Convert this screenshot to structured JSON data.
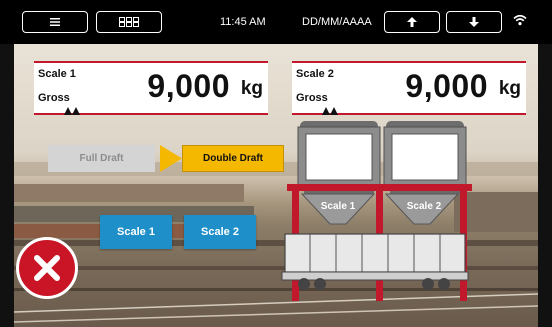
{
  "topbar": {
    "menu_icon": "menu-icon",
    "grid_icon": "grid-icon",
    "time": "11:45 AM",
    "date": "DD/MM/AAAA",
    "up_icon": "arrow-up-icon",
    "down_icon": "arrow-down-icon",
    "wifi_icon": "wifi-icon"
  },
  "scale1": {
    "name": "Scale 1",
    "mode": "Gross",
    "value": "9,000",
    "unit": "kg"
  },
  "scale2": {
    "name": "Scale 2",
    "mode": "Gross",
    "value": "9,000",
    "unit": "kg"
  },
  "draft": {
    "full": "Full Draft",
    "double": "Double Draft"
  },
  "buttons": {
    "scale1": "Scale 1",
    "scale2": "Scale 2"
  },
  "diagram": {
    "label1": "Scale 1",
    "label2": "Scale 2"
  },
  "colors": {
    "accent_red": "#c2182b",
    "draft_yellow": "#f5b800",
    "button_blue": "#1f8fc9"
  },
  "cancel_icon": "close-icon"
}
